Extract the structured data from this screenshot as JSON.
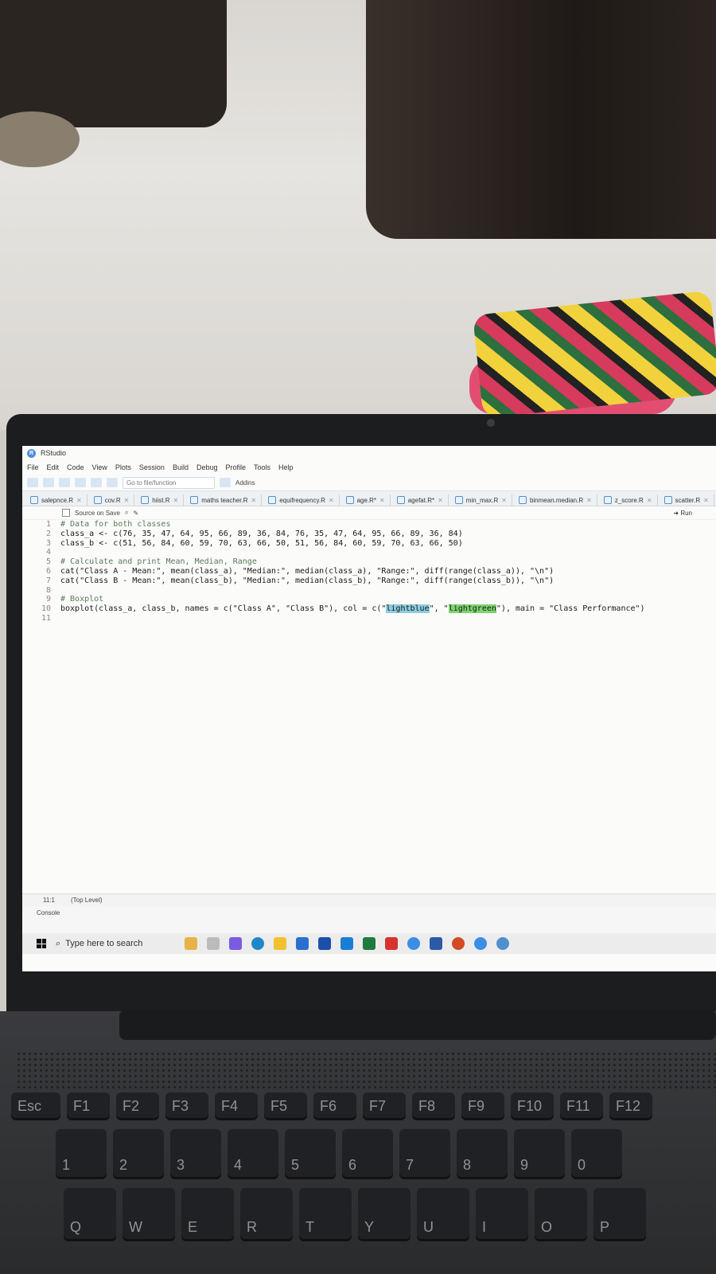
{
  "window": {
    "title": "RStudio"
  },
  "menu": [
    "File",
    "Edit",
    "Code",
    "View",
    "Plots",
    "Session",
    "Build",
    "Debug",
    "Profile",
    "Tools",
    "Help"
  ],
  "toolbar": {
    "goto_placeholder": "Go to file/function",
    "addins_label": "Addins"
  },
  "tabs": [
    {
      "label": "salepnce.R"
    },
    {
      "label": "cov.R"
    },
    {
      "label": "hiist.R"
    },
    {
      "label": "maths teacher.R"
    },
    {
      "label": "equifrequency.R"
    },
    {
      "label": "age.R*"
    },
    {
      "label": "agefat.R*"
    },
    {
      "label": "min_max.R"
    },
    {
      "label": "binmean.median.R"
    },
    {
      "label": "z_score.R"
    },
    {
      "label": "scatter.R"
    }
  ],
  "editor_toolbar": {
    "source_on_save": "Source on Save",
    "run_label": "Run"
  },
  "code_lines": [
    {
      "n": "1",
      "text": "# Data for both classes"
    },
    {
      "n": "2",
      "text": "class_a <- c(76, 35, 47, 64, 95, 66, 89, 36, 84, 76, 35, 47, 64, 95, 66, 89, 36, 84)"
    },
    {
      "n": "3",
      "text": "class_b <- c(51, 56, 84, 60, 59, 70, 63, 66, 50, 51, 56, 84, 60, 59, 70, 63, 66, 50)"
    },
    {
      "n": "4",
      "text": ""
    },
    {
      "n": "5",
      "text": "# Calculate and print Mean, Median, Range"
    },
    {
      "n": "6",
      "text": "cat(\"Class A - Mean:\", mean(class_a), \"Median:\", median(class_a), \"Range:\", diff(range(class_a)), \"\\n\")"
    },
    {
      "n": "7",
      "text": "cat(\"Class B - Mean:\", mean(class_b), \"Median:\", median(class_b), \"Range:\", diff(range(class_b)), \"\\n\")"
    },
    {
      "n": "8",
      "text": ""
    },
    {
      "n": "9",
      "text": "# Boxplot"
    },
    {
      "n": "10",
      "pre": "boxplot(class_a, class_b, names = c(\"Class A\", \"Class B\"), col = c(\"",
      "hl1": "lightblue",
      "mid": "\", \"",
      "hl2": "lightgreen",
      "post": "\"), main = \"Class Performance\")"
    },
    {
      "n": "11",
      "text": ""
    }
  ],
  "status": {
    "position": "11:1",
    "scope": "(Top Level)"
  },
  "console": {
    "label": "Console"
  },
  "taskbar": {
    "search_placeholder": "Type here to search"
  },
  "keyboard": {
    "row1": [
      "Esc",
      "F1",
      "F2",
      "F3",
      "F4",
      "F5",
      "F6",
      "F7",
      "F8",
      "F9",
      "F10",
      "F11",
      "F12"
    ],
    "row2": [
      "1",
      "2",
      "3",
      "4",
      "5",
      "6",
      "7",
      "8",
      "9",
      "0"
    ],
    "row3": [
      "Q",
      "W",
      "E",
      "R",
      "T",
      "Y",
      "U",
      "I",
      "O",
      "P"
    ]
  },
  "colors": {
    "highlight_blue": "#8ecde0",
    "highlight_green": "#7ed46e",
    "r_blue": "#4f8fd0"
  }
}
